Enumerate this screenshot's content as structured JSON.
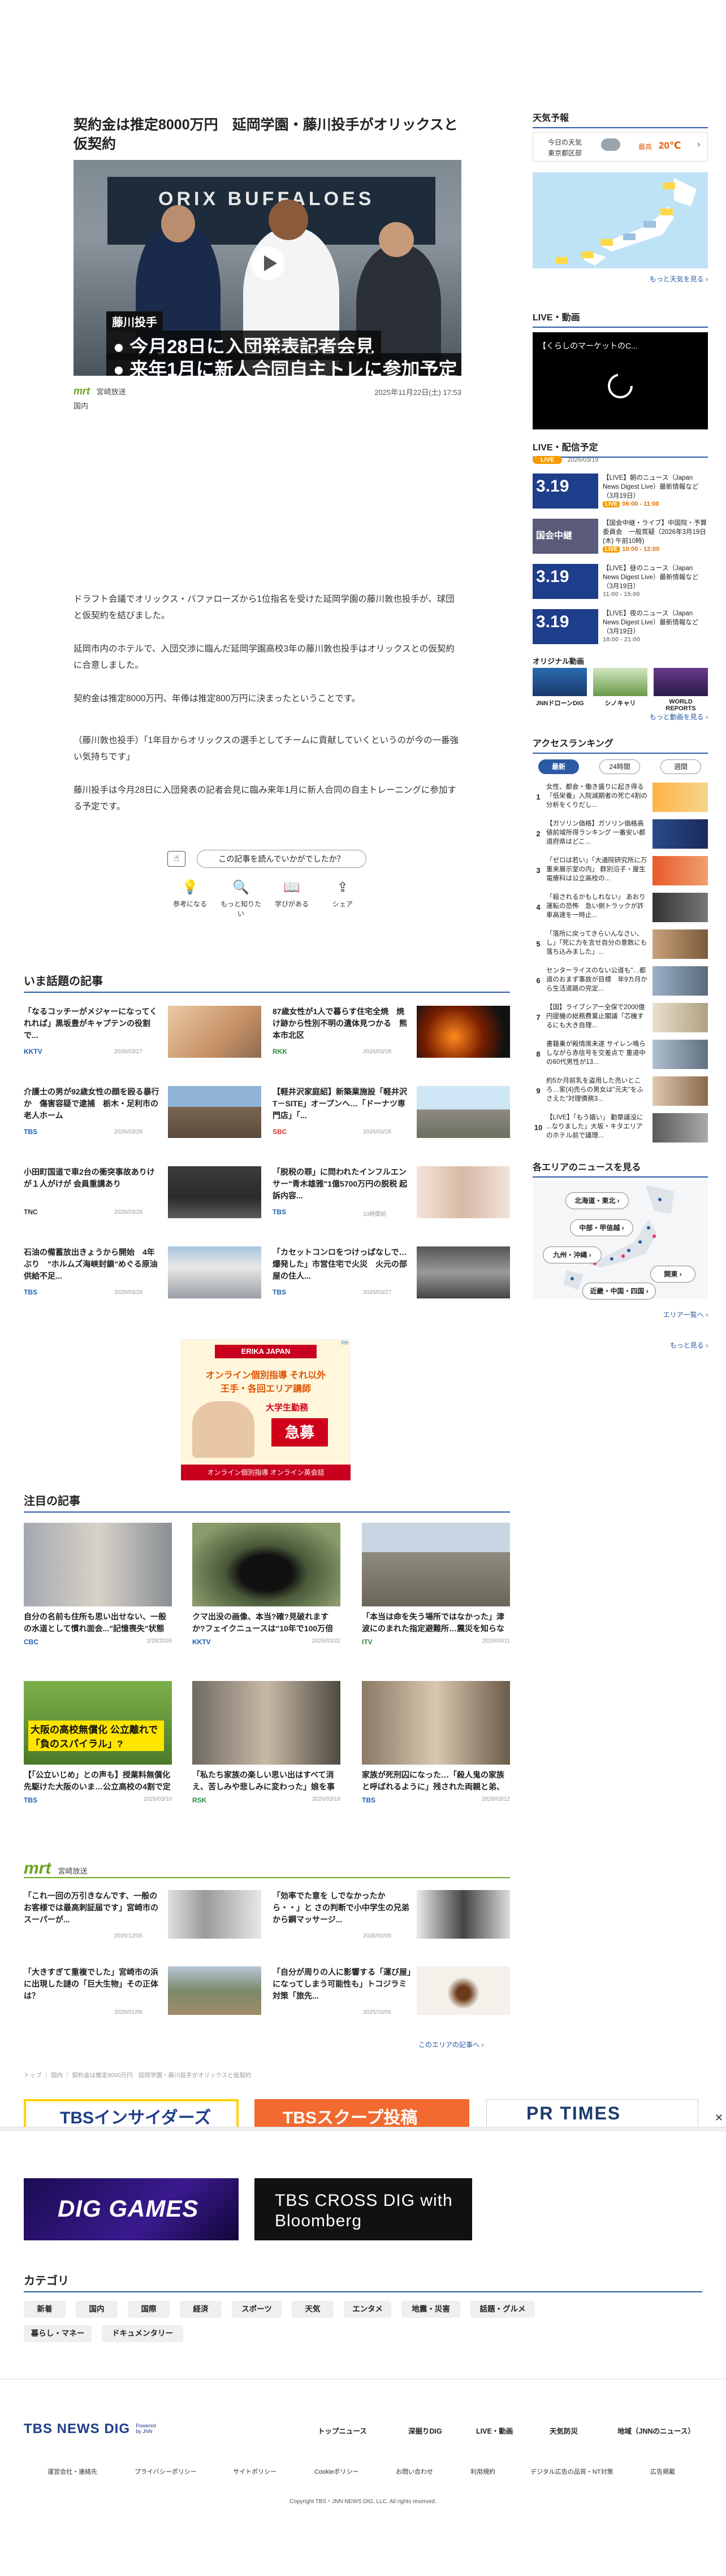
{
  "article": {
    "title": "契約金は推定8000万円　延岡学園・藤川投手がオリックスと仮契約",
    "hero": {
      "sign_text": "ORIX BUFFALOES",
      "tag": "藤川投手",
      "line1": "● 今月28日に入団発表記者会見",
      "line2": "● 来年1月に新人合同自主トレに参加予定"
    },
    "source": "mrt",
    "source_name": "宮崎放送",
    "date": "2025年11月22日(土) 17:53",
    "category": "国内",
    "paragraphs": [
      "ドラフト会議でオリックス・バファローズから1位指名を受けた延岡学園の藤川敦也投手が、球団と仮契約を結びました。",
      "延岡市内のホテルで、入団交渉に臨んだ延岡学園高校3年の藤川敦也投手はオリックスとの仮契約に合意しました。",
      "契約金は推定8000万円、年俸は推定800万円に決まったということです。",
      "（藤川敦也投手）「1年目からオリックスの選手としてチームに貢献していくというのが今の一番強い気持ちです」",
      "藤川投手は今月28日に入団発表の記者会見に臨み来年1月に新人合同の自主トレーニングに参加する予定です。"
    ]
  },
  "survey": {
    "question": "この記事を読んでいかがでしたか？",
    "options": [
      "参考になる",
      "もっと知りたい",
      "学びがある",
      "シェア"
    ]
  },
  "trending": {
    "heading": "いま話題の記事",
    "items": [
      {
        "title": "「なるコッチーがメジャーになってくれれば」黒坂豊がキャプテンの役割で...",
        "src": "KKTV",
        "date": "2026/03/27"
      },
      {
        "title": "87歳女性が1人で暮らす住宅全焼　焼け跡から性別不明の遺体見つかる　熊本市北区",
        "src": "RKK",
        "date": "2026/03/28"
      },
      {
        "title": "介護士の男が92歳女性の顔を殴る暴行か　傷害容疑で逮捕　栃木・足利市の老人ホーム",
        "src": "TBS",
        "date": "2026/03/28"
      },
      {
        "title": "【軽井沢家庭紹】新築業施設「軽井沢T－SITE」オープンへ…「ドーナツ専門店」「...",
        "src": "SBC",
        "date": "2026/03/28"
      },
      {
        "title": "小田町国道で車2台の衝突事故ありけが１人がけが 会員重講あり",
        "src": "TNC",
        "date": "2026/03/28"
      },
      {
        "title": "「脱税の罪」に問われたインフルエンサー\"青木雄雅\"1億5700万円の脱税 起訴内容...",
        "src": "TBS",
        "date": "10時間前"
      },
      {
        "title": "石油の備蓄放出きょうから開始　4年ぶり　\"ホルムズ海峡封鎖\"めぐる原油供給不足...",
        "src": "TBS",
        "date": "2026/03/28"
      },
      {
        "title": "「カセットコンロをつけっぱなしで…爆発した」市営住宅で火災　火元の部屋の住人...",
        "src": "TBS",
        "date": "2026/03/27"
      }
    ]
  },
  "ad": {
    "tag": "PR",
    "brand": "ERIKA JAPAN",
    "line1": "オンライン個別指導 それ以外",
    "line2": "王手・各回エリア講師",
    "line3": "大学生勤務",
    "cta": "急募",
    "footer": "オンライン個別指導 オンライン英会話"
  },
  "featured": {
    "heading": "注目の記事",
    "items": [
      {
        "title": "自分の名前も住所も思い出せない、一般の水道として慣れ面会...\"記憶喪失\"状態 愛知・岡崎市が...",
        "src": "CBC",
        "date": "2/28/2026"
      },
      {
        "title": "クマ出没の画像、本当?確?見破れますか?フェイクニュースは\"10年で100万倍増\"見破るには",
        "src": "KKTV",
        "date": "2026/03/22"
      },
      {
        "title": "「本当は命を失う場所ではなかった」津波にのまれた指定避難所…震災を知らない大学生が被災地...",
        "src": "ITV",
        "date": "2026/03/11"
      },
      {
        "title": "【「公立いじめ」との声も】授業料無償化先駆けた大阪のいま…公立高校の4割で定員割れ「私立...",
        "src": "TBS",
        "date": "2026/03/10"
      },
      {
        "title": "「私たち家族の楽しい思い出はすべて消え、苦しみや悲しみに変わった」娘を事故で失った小学校の...",
        "src": "RSK",
        "date": "2026/03/18"
      },
      {
        "title": "家族が死刑囚になった…「殺人鬼の家族と呼ばれるように」残された両親と弟、過酷な現実の中で...",
        "src": "TBS",
        "date": "2026/03/12"
      }
    ],
    "hero3_caption": "大阪の高校無償化 公立離れで「負のスパイラル」?"
  },
  "mrt_section": {
    "logo": "mrt",
    "name": "宮崎放送",
    "items": [
      {
        "title": "「これ一回の万引きなんです、一般のお客様では最高刺証届です」宮崎市のスーパーが...",
        "date": "2025/12/05"
      },
      {
        "title": "「効率でた意を しでなかったから・・」と さの判断で小中学生の兄弟から鋼マッサージ...",
        "date": "2026/02/05"
      },
      {
        "title": "「大きすぎて重複でした」宮崎市の浜に出現した謎の「巨大生物」その正体は？",
        "date": "2026/01/06"
      },
      {
        "title": "「自分が周りの人に影響する「運び屋」になってしまう可能性も」トコジラミ対策「旅先...",
        "date": "2025/10/06"
      }
    ],
    "more": "このエリアの記事へ ›"
  },
  "breadcrumb": "トップ ｜ 国内 ｜ 契約金は推定8000万円　延岡学園・藤川投手がオリックスと仮契約",
  "banners": [
    "TBSインサイダーズ",
    "TBSスクープ投稿",
    "PR TIMES",
    "DIG GAMES",
    "TBS CROSS DIG with Bloomberg"
  ],
  "categories": {
    "heading": "カテゴリ",
    "items": [
      "新着",
      "国内",
      "国際",
      "経済",
      "スポーツ",
      "天気",
      "エンタメ",
      "地震・災害",
      "話題・グルメ",
      "暮らし・マネー",
      "ドキュメンタリー"
    ]
  },
  "footer": {
    "logo": "TBS NEWS DIG",
    "powered": "Powered by JNN",
    "nav": [
      "トップニュース",
      "深掘りDIG",
      "LIVE・動画",
      "天気防災",
      "地域（JNNのニュース）"
    ],
    "links": [
      "運営会社・連絡先",
      "プライバシーポリシー",
      "サイトポリシー",
      "Cookieポリシー",
      "お問い合わせ",
      "利用規約",
      "デジタル広告の品質・NT対策",
      "広告掲載"
    ],
    "copyright": "Copyright TBS・JNN NEWS DIG, LLC. All rights reserved."
  },
  "sidebar": {
    "weather": {
      "heading": "天気予報",
      "label1": "今日の天気",
      "label2": "東京都区部",
      "high_label": "最高",
      "high": "20℃",
      "more": "もっと天気を見る ›"
    },
    "video": {
      "heading": "LIVE・動画",
      "title": "【くらしのマーケットのC..."
    },
    "live": {
      "heading": "LIVE・配信予定",
      "date_badge": "2026/03/19",
      "items": [
        {
          "thumb": "3.19",
          "title": "【LIVE】朝のニュース（Japan News Digest Live）最新情報など（3月19日）",
          "time": "06:00 - 11:00"
        },
        {
          "thumb": "国会中継",
          "title": "【国会中継・ライブ】中国院・予算委員会　一般質疑（2026年3月19日 (木) 午前10時)",
          "time": "10:00 - 12:00"
        },
        {
          "title": "【LIVE】昼のニュース（Japan News Digest Live）最新情報など（3月19日）",
          "thumb": "3.19",
          "time": "11:00 - 15:00"
        },
        {
          "title": "【LIVE】夜のニュース（Japan News Digest Live）最新情報など（3月19日）",
          "thumb": "3.19",
          "time": "18:00 - 21:00"
        }
      ]
    },
    "original": {
      "heading": "オリジナル動画",
      "items": [
        "JNNドローンDIG",
        "シノキャリ",
        "WORLD REPORTS"
      ],
      "more": "もっと動画を見る ›"
    },
    "ranking": {
      "heading": "アクセスランキング",
      "tabs": [
        "最新",
        "24時間",
        "週間"
      ],
      "items": [
        "女性、都会・働き盛りに起き得る「低栄養」入院減期者の死亡4割の分析をくりだし...",
        "【ガソリン価格】ガソリン価格高値前域所得ランキング  一番安い都道府県はどこ...",
        "「ゼロは若い」「大通院研究所に万重来展示室の内」 群別沿子・屋生電療科は公立高校の...",
        "「殺されるかもしれない」 あおり運転の恐怖　急い側トラックが詐車高速を一時止...",
        "「落所に戻ってきらいんなさい、し」「死に力を言せ自分の意数にも落ち込みました」...",
        "センターライスのない公道も\"…都道のおまず事故が目標　年9カ月から生活道路の完定...",
        "【国】ライブシアー全保で2000億円提機の総務費業止閣議「芯機するにも大き自理...",
        "書籍乗が殿情席未遂 サイレン鳴らしながら赤信号を交差点で 重道中の60代男性が13...",
        "約5か月前乳を盗用した売いところ…家(4)売らの男女は\"元夫\"をふさえた\"対理債務3...",
        "【LIVE】「もう嬉い」 勤章議没に ...なりました」大坂・キタエリアのホテル前で議理..."
      ]
    },
    "regions": {
      "heading": "各エリアのニュースを見る",
      "buttons": [
        "北海道・東北 ›",
        "中部・甲信越 ›",
        "九州・沖縄 ›",
        "関東 ›",
        "近畿・中国・四国 ›"
      ],
      "link": "エリア一覧へ ›",
      "more": "もっと見る ›"
    }
  },
  "colors": {
    "accent": "#2a5aa4",
    "mrt": "#6aa51d",
    "orange": "#f59b00"
  }
}
